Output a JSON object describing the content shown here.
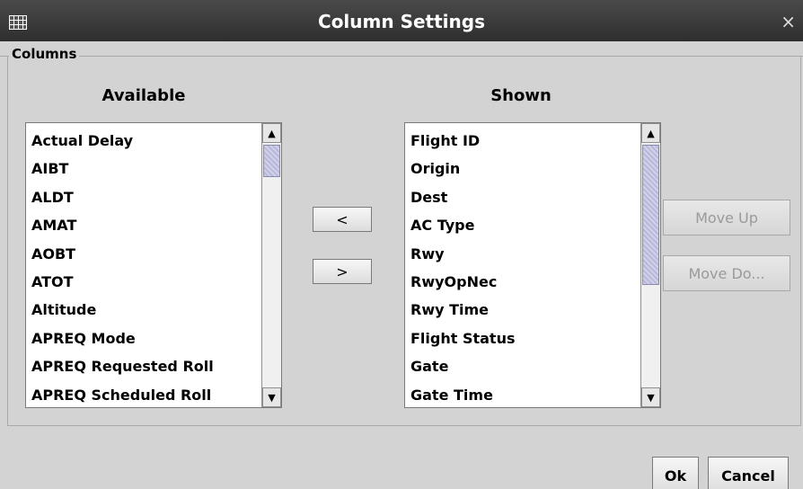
{
  "window": {
    "title": "Column Settings",
    "close_glyph": "×",
    "icon": "table-icon"
  },
  "group": {
    "label": "Columns"
  },
  "available": {
    "title": "Available",
    "items": [
      "Actual Delay",
      "AIBT",
      "ALDT",
      "AMAT",
      "AOBT",
      "ATOT",
      "Altitude",
      "APREQ Mode",
      "APREQ Requested Roll",
      "APREQ Scheduled Roll"
    ]
  },
  "shown": {
    "title": "Shown",
    "items": [
      "Flight ID",
      "Origin",
      "Dest",
      "AC Type",
      "Rwy",
      "RwyOpNec",
      "Rwy Time",
      "Flight Status",
      "Gate",
      "Gate Time"
    ]
  },
  "transfer": {
    "remove_label": "<",
    "add_label": ">"
  },
  "order": {
    "move_up_label": "Move Up",
    "move_down_label": "Move Do..."
  },
  "footer": {
    "ok_label": "Ok",
    "cancel_label": "Cancel"
  },
  "scroll_glyphs": {
    "up": "▲",
    "down": "▼"
  }
}
